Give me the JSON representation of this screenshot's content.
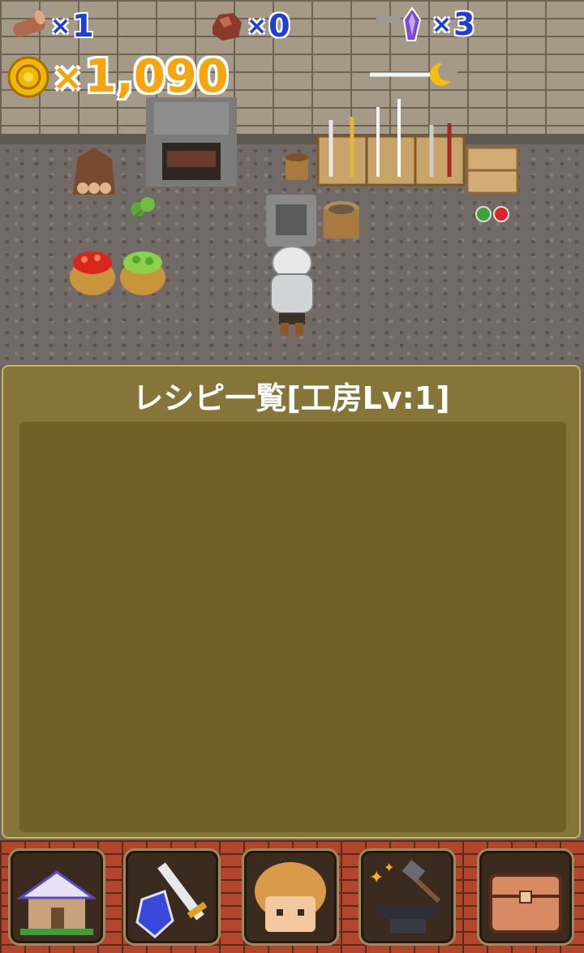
{
  "hud": {
    "wood_count": "1",
    "ore_count": "0",
    "crystal_count": "3",
    "multiplier": "×",
    "gold_amount": "1,090"
  },
  "recipe_panel": {
    "title": "レシピ一覧[工房Lv:1]"
  },
  "nav": {
    "items": [
      {
        "icon": "house-icon"
      },
      {
        "icon": "sword-shield-icon"
      },
      {
        "icon": "character-icon"
      },
      {
        "icon": "anvil-hammer-icon"
      },
      {
        "icon": "treasure-chest-icon"
      }
    ]
  },
  "colors": {
    "counter_text": "#1d3fd6",
    "gold_text": "#f5a60e",
    "panel_bg": "#867538",
    "panel_list_bg": "#6f6127",
    "bottom_bar": "#b2462d"
  }
}
